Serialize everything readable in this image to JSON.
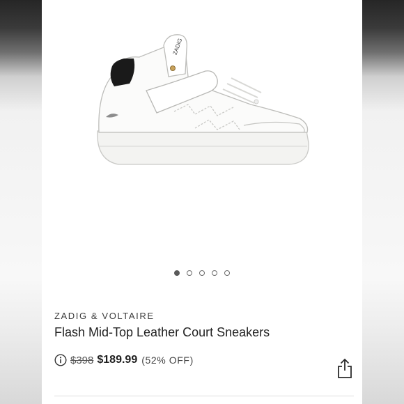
{
  "product": {
    "brand": "ZADIG & VOLTAIRE",
    "title": "Flash Mid-Top Leather Court Sneakers",
    "original_price": "$398",
    "sale_price": "$189.99",
    "discount": "(52% OFF)",
    "image_label": "ZADIG"
  },
  "carousel": {
    "total_images": 5,
    "active_index": 0
  },
  "icons": {
    "info": "info-circle-icon",
    "share": "share-icon"
  },
  "colors": {
    "text_primary": "#222222",
    "accent_dark": "#1e1e1e",
    "dot_active": "#5a5a5a"
  }
}
